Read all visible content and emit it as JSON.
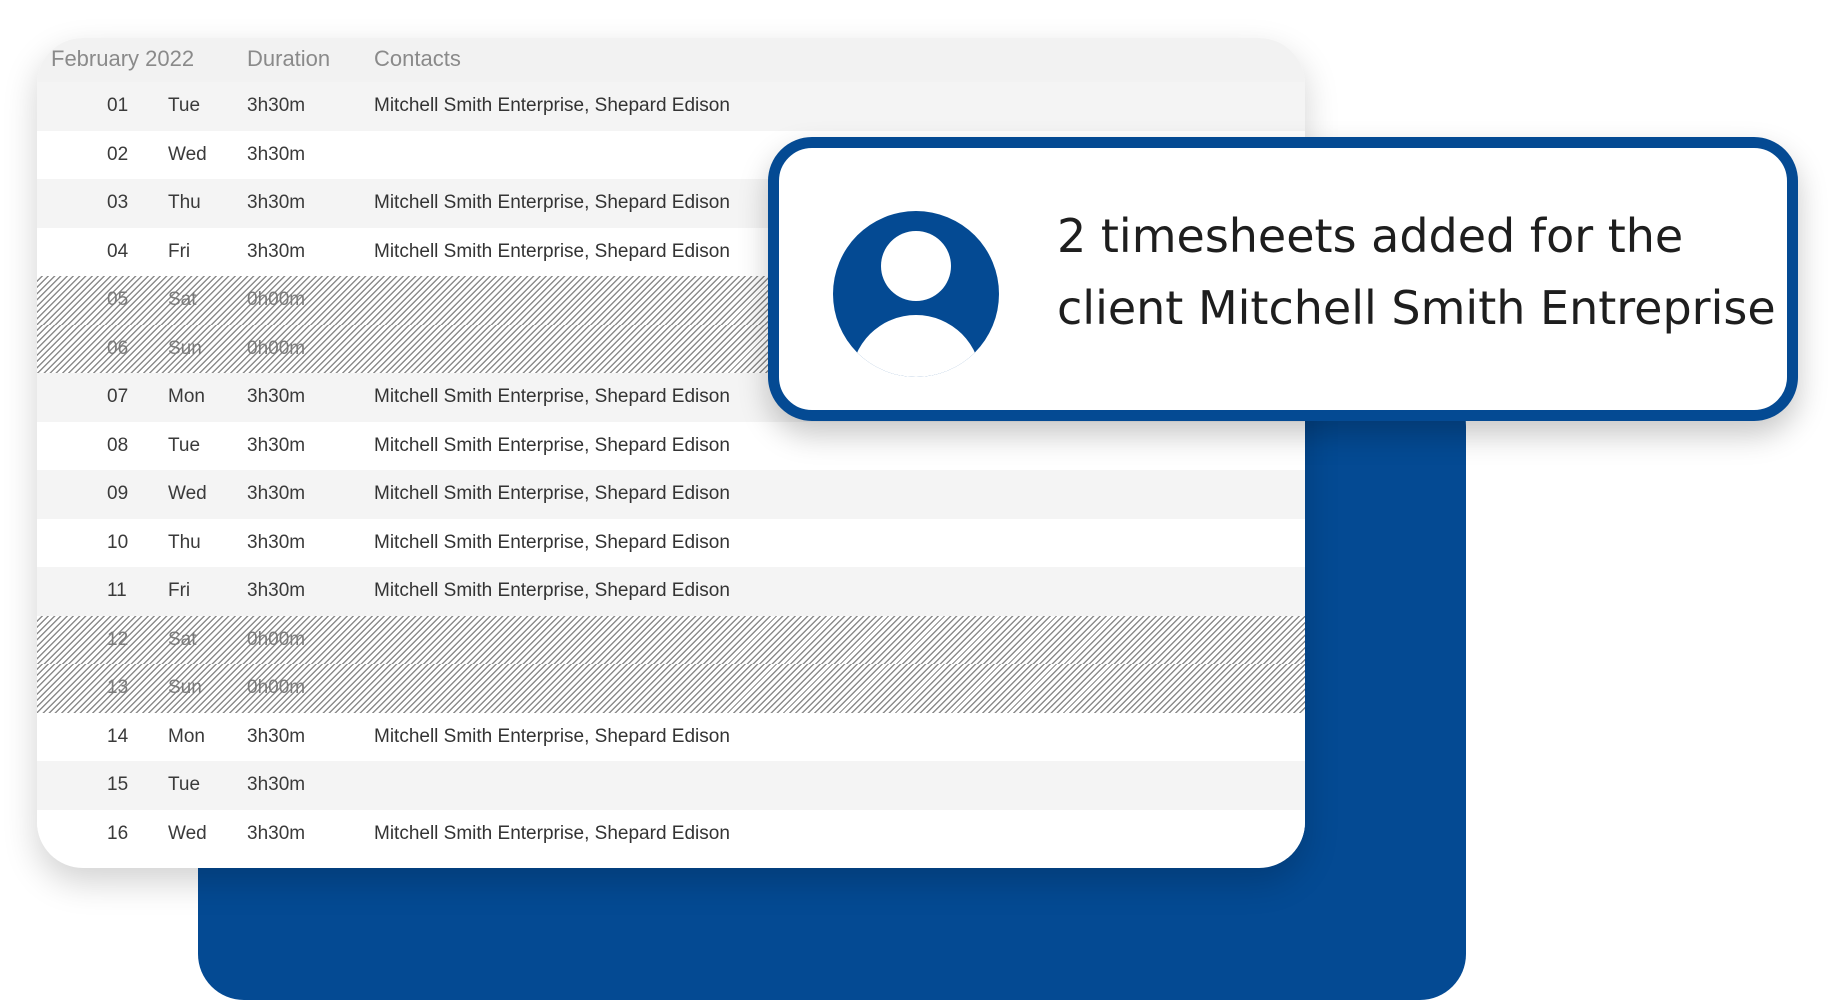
{
  "table": {
    "headers": {
      "month": "February 2022",
      "duration": "Duration",
      "contacts": "Contacts"
    },
    "rows": [
      {
        "day": "01",
        "weekday": "Tue",
        "duration": "3h30m",
        "contacts": "Mitchell Smith Enterprise, Shepard Edison",
        "weekend": false
      },
      {
        "day": "02",
        "weekday": "Wed",
        "duration": "3h30m",
        "contacts": "",
        "weekend": false
      },
      {
        "day": "03",
        "weekday": "Thu",
        "duration": "3h30m",
        "contacts": "Mitchell Smith Enterprise, Shepard Edison",
        "weekend": false
      },
      {
        "day": "04",
        "weekday": "Fri",
        "duration": "3h30m",
        "contacts": "Mitchell Smith Enterprise, Shepard Edison",
        "weekend": false
      },
      {
        "day": "05",
        "weekday": "Sat",
        "duration": "0h00m",
        "contacts": "",
        "weekend": true
      },
      {
        "day": "06",
        "weekday": "Sun",
        "duration": "0h00m",
        "contacts": "",
        "weekend": true
      },
      {
        "day": "07",
        "weekday": "Mon",
        "duration": "3h30m",
        "contacts": "Mitchell Smith Enterprise, Shepard Edison",
        "weekend": false
      },
      {
        "day": "08",
        "weekday": "Tue",
        "duration": "3h30m",
        "contacts": "Mitchell Smith Enterprise, Shepard Edison",
        "weekend": false
      },
      {
        "day": "09",
        "weekday": "Wed",
        "duration": "3h30m",
        "contacts": "Mitchell Smith Enterprise, Shepard Edison",
        "weekend": false
      },
      {
        "day": "10",
        "weekday": "Thu",
        "duration": "3h30m",
        "contacts": "Mitchell Smith Enterprise, Shepard Edison",
        "weekend": false
      },
      {
        "day": "11",
        "weekday": "Fri",
        "duration": "3h30m",
        "contacts": "Mitchell Smith Enterprise, Shepard Edison",
        "weekend": false
      },
      {
        "day": "12",
        "weekday": "Sat",
        "duration": "0h00m",
        "contacts": "",
        "weekend": true
      },
      {
        "day": "13",
        "weekday": "Sun",
        "duration": "0h00m",
        "contacts": "",
        "weekend": true
      },
      {
        "day": "14",
        "weekday": "Mon",
        "duration": "3h30m",
        "contacts": "Mitchell Smith Enterprise, Shepard Edison",
        "weekend": false
      },
      {
        "day": "15",
        "weekday": "Tue",
        "duration": "3h30m",
        "contacts": "",
        "weekend": false
      },
      {
        "day": "16",
        "weekday": "Wed",
        "duration": "3h30m",
        "contacts": "Mitchell Smith Enterprise, Shepard Edison",
        "weekend": false
      }
    ]
  },
  "notification": {
    "line1": "2 timesheets added for the",
    "line2": "client Mitchell Smith Entreprise",
    "icon": "user-icon"
  },
  "colors": {
    "brand_blue": "#044a93",
    "row_alt": "#f4f4f4",
    "header_bg": "#f2f2f2"
  }
}
